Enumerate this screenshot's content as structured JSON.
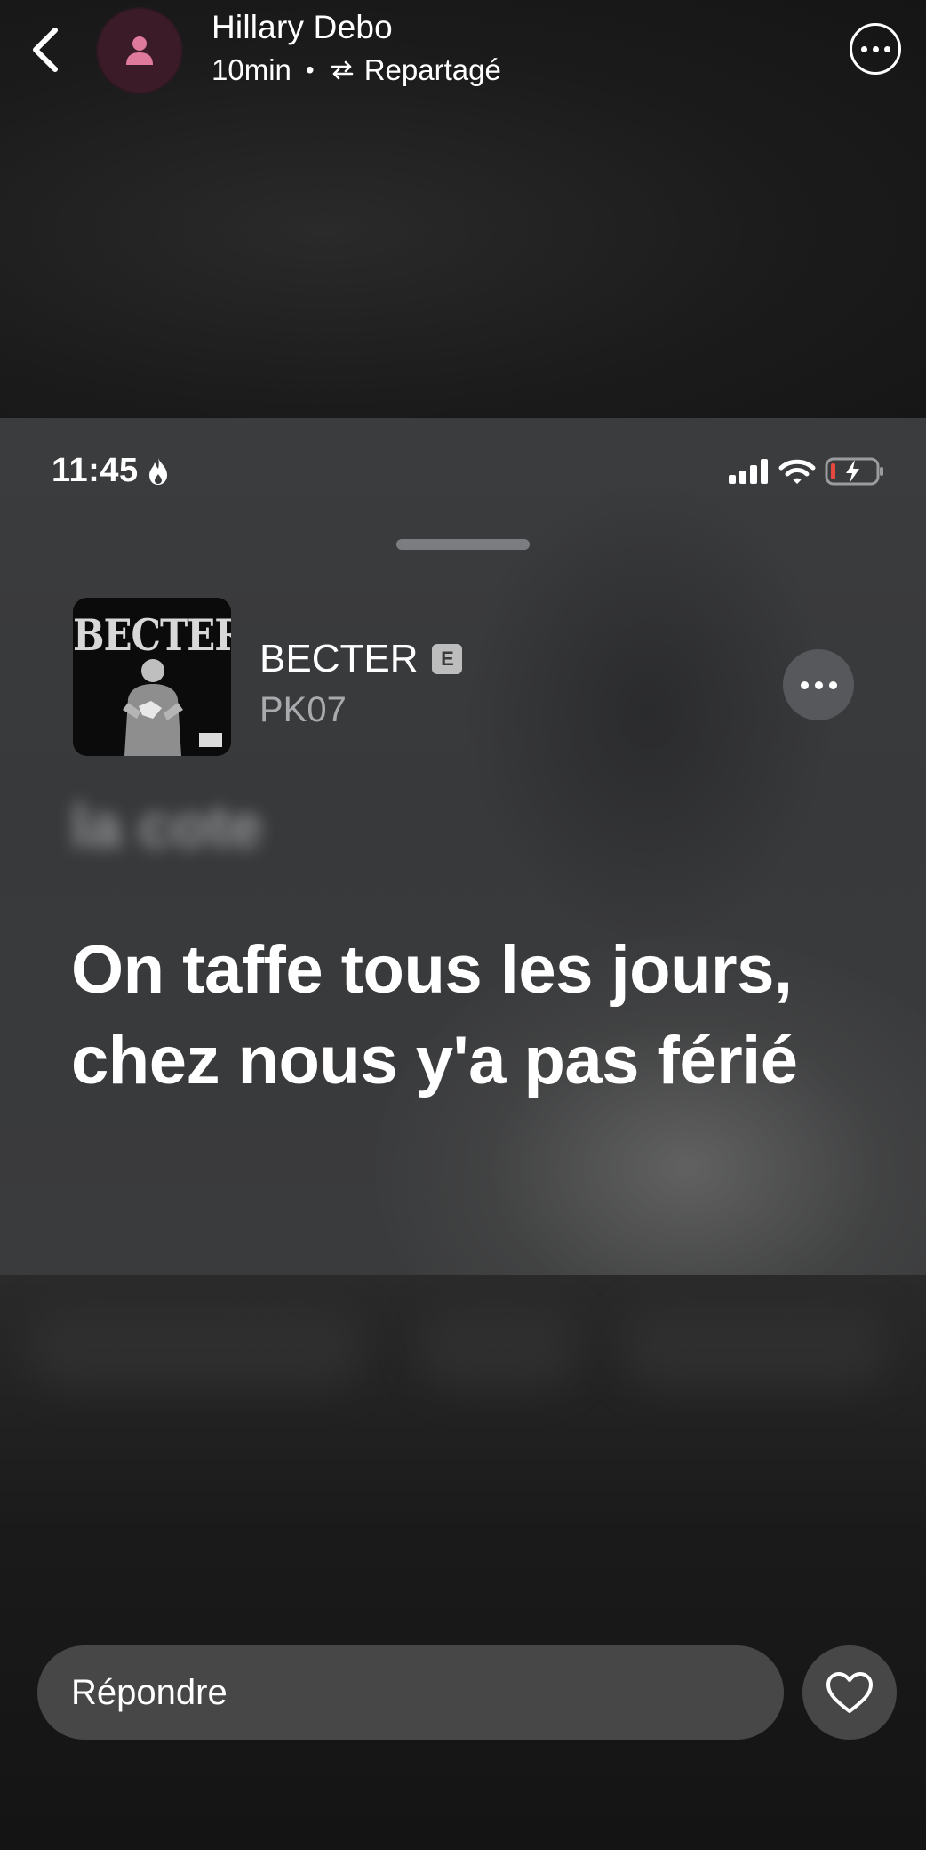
{
  "header": {
    "user_name": "Hillary Debo",
    "time_ago": "10min",
    "separator": "•",
    "shared_label": "Repartagé"
  },
  "shared_screenshot": {
    "status_bar": {
      "time": "11:45"
    },
    "track": {
      "cover_text": "BECTER",
      "title": "BECTER",
      "explicit_badge": "E",
      "artist": "PK07"
    },
    "previous_lyric": "la cote",
    "current_lyric": "On taffe tous les jours, chez nous y'a pas férié"
  },
  "reply": {
    "placeholder": "Répondre"
  },
  "icons": {
    "back": "chevron-left-icon",
    "avatar": "person-icon",
    "repost": "repost-icon",
    "more": "more-horizontal-icon",
    "like": "heart-icon"
  },
  "colors": {
    "background": "#141414",
    "card": "#3a3b3d",
    "input": "#474747",
    "avatar_bg": "#3a1b27",
    "avatar_icon": "#e07a9d"
  }
}
